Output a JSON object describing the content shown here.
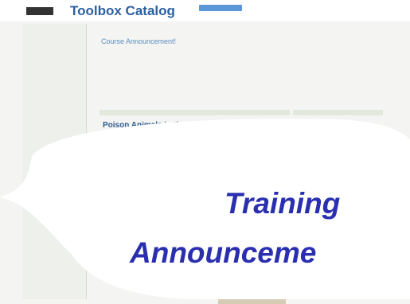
{
  "topbar": {
    "logo": "",
    "logo_suffix": "",
    "app_title": "Toolbox Catalog",
    "tabs": [
      "",
      ""
    ],
    "right_link": ""
  },
  "sidebar": {
    "items": [
      "",
      "",
      "",
      "",
      "",
      "",
      "",
      "",
      "",
      "",
      "",
      "",
      "",
      "",
      "",
      "",
      "",
      "",
      "",
      "",
      "",
      "",
      "",
      "",
      "",
      "",
      "",
      "",
      "",
      "",
      "",
      "",
      "",
      "",
      "",
      "",
      "",
      "",
      "",
      "",
      "",
      "",
      "",
      "",
      "",
      "",
      "",
      "",
      ""
    ]
  },
  "main": {
    "breadcrumb": "",
    "course_title": "Course Announcement!",
    "course_text": "",
    "panel_header": "",
    "side_header": "",
    "article_title": "Poison Animals in the Area",
    "article_meta": [
      "",
      "",
      "",
      ""
    ],
    "side_subtitle": "",
    "side_link": "",
    "body_text": ""
  },
  "overlay": {
    "line1": "Training",
    "line2": "Announceme"
  },
  "colors": {
    "accent": "#2a2fb0",
    "title_blue": "#2c5fa0",
    "tab_blue": "#5b97d6",
    "selected_nav": "#f3d27a"
  }
}
